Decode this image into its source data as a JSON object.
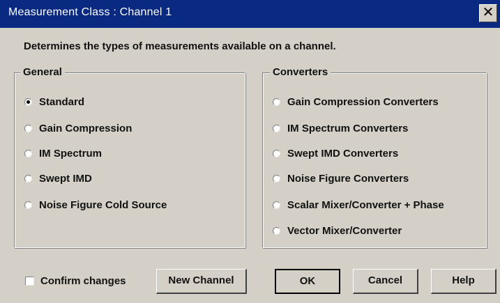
{
  "window": {
    "title": "Measurement Class : Channel 1",
    "close_glyph": "✕"
  },
  "description": "Determines the types of measurements available on a channel.",
  "general": {
    "legend": "General",
    "items": [
      {
        "label": "Standard",
        "selected": true
      },
      {
        "label": "Gain Compression",
        "selected": false
      },
      {
        "label": "IM Spectrum",
        "selected": false
      },
      {
        "label": "Swept IMD",
        "selected": false
      },
      {
        "label": "Noise Figure Cold Source",
        "selected": false
      }
    ]
  },
  "converters": {
    "legend": "Converters",
    "items": [
      {
        "label": "Gain Compression Converters",
        "selected": false
      },
      {
        "label": "IM Spectrum Converters",
        "selected": false
      },
      {
        "label": "Swept IMD Converters",
        "selected": false
      },
      {
        "label": "Noise Figure Converters",
        "selected": false
      },
      {
        "label": "Scalar Mixer/Converter + Phase",
        "selected": false
      },
      {
        "label": "Vector Mixer/Converter",
        "selected": false
      }
    ]
  },
  "footer": {
    "confirm_label": "Confirm changes",
    "confirm_checked": false,
    "new_channel_label": "New Channel",
    "ok_label": "OK",
    "cancel_label": "Cancel",
    "help_label": "Help"
  }
}
